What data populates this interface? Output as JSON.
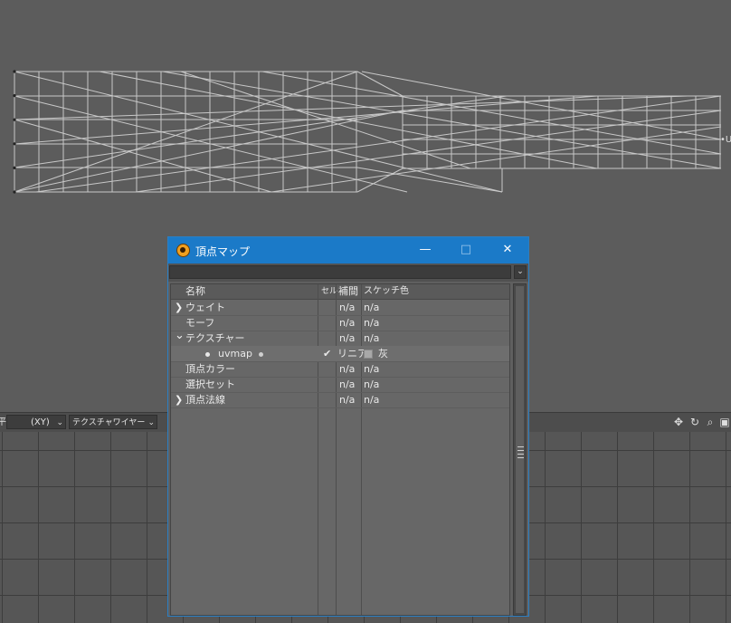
{
  "viewport_top": {
    "axis_marker": "•U"
  },
  "toolbar": {
    "view_fragment": "平面",
    "projection": "(XY)",
    "render_mode": "テクスチャワイヤー",
    "icons": [
      "move-view-icon",
      "rotate-view-icon",
      "zoom-view-icon",
      "maximize-view-icon"
    ]
  },
  "dialog": {
    "title": "頂点マップ",
    "buttons": {
      "minimize": "—",
      "maximize": "□",
      "close": "✕"
    },
    "filter_placeholder": "",
    "columns": {
      "name": "名称",
      "cell": "セル",
      "interp": "補間",
      "sketch": "スケッチ色"
    },
    "rows": [
      {
        "name": "ウェイト",
        "expander": "❯",
        "cell": "",
        "interp": "n/a",
        "sketch": "n/a"
      },
      {
        "name": "モーフ",
        "expander": "",
        "cell": "",
        "interp": "n/a",
        "sketch": "n/a"
      },
      {
        "name": "テクスチャー",
        "expander": "⌄",
        "cell": "",
        "interp": "n/a",
        "sketch": "n/a"
      },
      {
        "name": "uvmap",
        "expander": "",
        "cell": "✔",
        "interp": "リニア",
        "sketch": "灰"
      },
      {
        "name": "頂点カラー",
        "expander": "",
        "cell": "",
        "interp": "n/a",
        "sketch": "n/a"
      },
      {
        "name": "選択セット",
        "expander": "",
        "cell": "",
        "interp": "n/a",
        "sketch": "n/a"
      },
      {
        "name": "頂点法線",
        "expander": "❯",
        "cell": "",
        "interp": "n/a",
        "sketch": "n/a"
      }
    ]
  },
  "colors": {
    "titlebar": "#1b7ac8",
    "background": "#5c5c5c",
    "wireframe": "#c8c8c8",
    "sketch_gray": "#a8a8a8"
  }
}
